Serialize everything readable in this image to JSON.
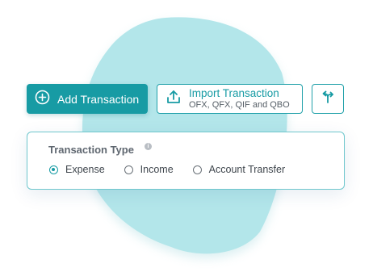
{
  "buttons": {
    "add_label": "Add Transaction",
    "import_title": "Import Transaction",
    "import_formats": "OFX, QFX, QIF and QBO"
  },
  "transaction_type": {
    "title": "Transaction Type",
    "info_glyph": "i",
    "options": [
      {
        "label": "Expense",
        "selected": true
      },
      {
        "label": "Income",
        "selected": false
      },
      {
        "label": "Account Transfer",
        "selected": false
      }
    ]
  },
  "colors": {
    "accent": "#179ba4",
    "blob": "#b3e6ea",
    "card_border": "#6fc7cd"
  },
  "icons": [
    "plus-circle-icon",
    "upload-icon",
    "transfer-arrows-icon",
    "info-icon"
  ]
}
